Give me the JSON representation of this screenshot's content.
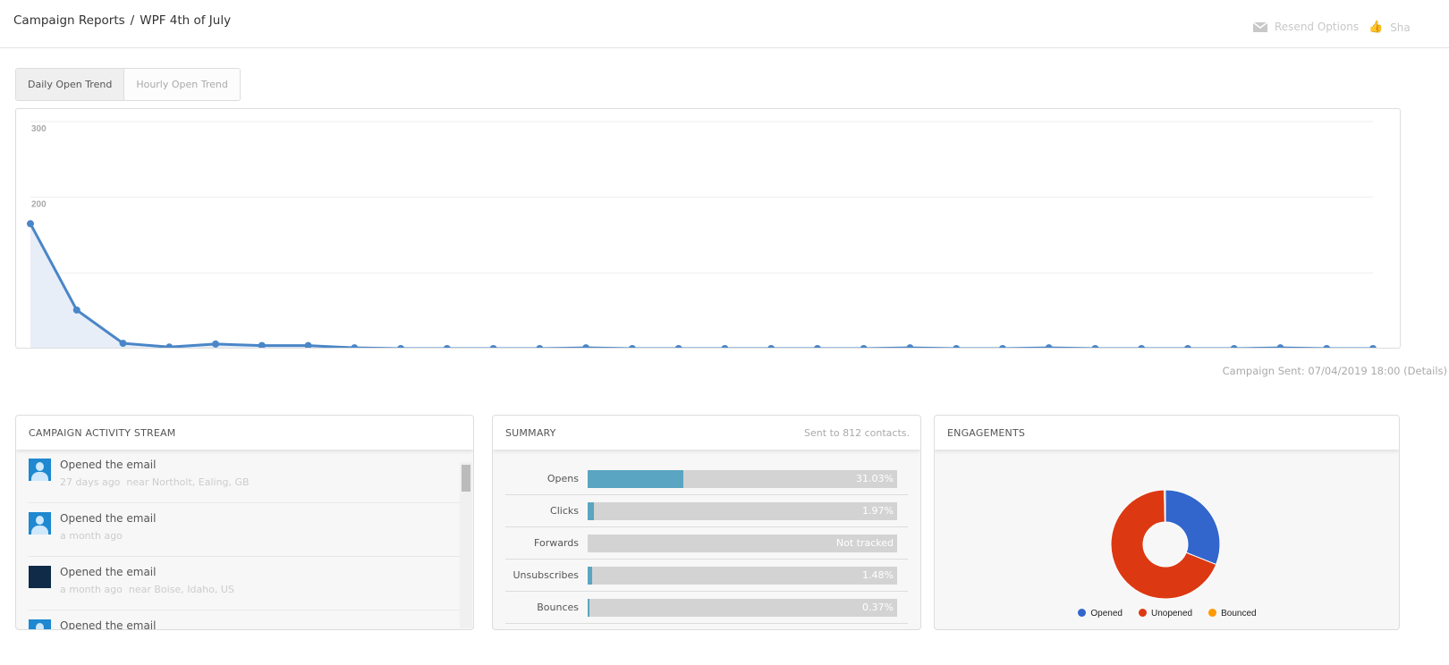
{
  "breadcrumb": {
    "parent": "Campaign Reports",
    "separator": "/",
    "current": "WPF 4th of July"
  },
  "top_actions": [
    {
      "label": "Resend Options",
      "icon": "envelope-icon"
    },
    {
      "label": "Sha",
      "icon": "thumbs-up-icon"
    }
  ],
  "tabs": [
    {
      "label": "Daily Open Trend",
      "active": true
    },
    {
      "label": "Hourly Open Trend",
      "active": false
    }
  ],
  "chart_data": {
    "type": "line",
    "title": "",
    "xlabel": "",
    "ylabel": "",
    "ylim": [
      0,
      300
    ],
    "yticks": [
      "100",
      "200",
      "300"
    ],
    "values": [
      165,
      51,
      7,
      2,
      6,
      4,
      4,
      1,
      0,
      0,
      0,
      0,
      1,
      0,
      0,
      0,
      0,
      0,
      0,
      1,
      0,
      0,
      1,
      0,
      0,
      0,
      0,
      1,
      0,
      0
    ],
    "color": "#4a86c8"
  },
  "campaign_sent": "Campaign Sent: 07/04/2019 18:00 (Details)",
  "activity": {
    "title": "CAMPAIGN ACTIVITY STREAM",
    "items": [
      {
        "action": "Opened the email",
        "time": "27 days ago",
        "location": "near Northolt, Ealing, GB",
        "avatar": "person"
      },
      {
        "action": "Opened the email",
        "time": "a month ago",
        "location": "",
        "avatar": "person"
      },
      {
        "action": "Opened the email",
        "time": "a month ago",
        "location": "near Boise, Idaho, US",
        "avatar": "logo"
      },
      {
        "action": "Opened the email",
        "time": "",
        "location": "",
        "avatar": "person"
      }
    ]
  },
  "summary": {
    "title": "SUMMARY",
    "sent": "Sent to 812 contacts.",
    "rows": [
      {
        "label": "Opens",
        "value": "31.03%",
        "pct": 31.03
      },
      {
        "label": "Clicks",
        "value": "1.97%",
        "pct": 1.97
      },
      {
        "label": "Forwards",
        "value": "Not tracked",
        "pct": 0
      },
      {
        "label": "Unsubscribes",
        "value": "1.48%",
        "pct": 1.48
      },
      {
        "label": "Bounces",
        "value": "0.37%",
        "pct": 0.37
      }
    ]
  },
  "engagements": {
    "title": "ENGAGEMENTS",
    "slices": [
      {
        "label": "Opened",
        "value": 31.03,
        "color": "#3366cc"
      },
      {
        "label": "Unopened",
        "value": 68.6,
        "color": "#dc3912"
      },
      {
        "label": "Bounced",
        "value": 0.37,
        "color": "#ff9900"
      }
    ]
  }
}
